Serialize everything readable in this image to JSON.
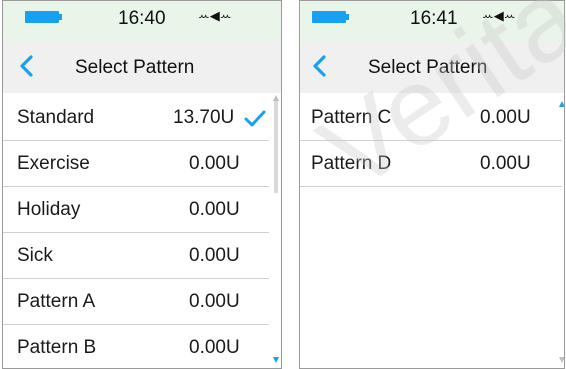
{
  "colors": {
    "accent": "#18a1f2",
    "status_bar_bg": "#e9f5e9",
    "title_bar_bg": "#f0f0f0",
    "divider": "#d0d0d0"
  },
  "screens": [
    {
      "status": {
        "time": "16:40",
        "battery_icon": "battery-icon",
        "mode_icon": "silent-vibrate-icon"
      },
      "header": {
        "back_icon": "back-chevron-icon",
        "title": "Select Pattern"
      },
      "rows": [
        {
          "name": "Standard",
          "value": "13.70U",
          "selected": true
        },
        {
          "name": "Exercise",
          "value": "0.00U"
        },
        {
          "name": "Holiday",
          "value": "0.00U"
        },
        {
          "name": "Sick",
          "value": "0.00U"
        },
        {
          "name": "Pattern A",
          "value": "0.00U"
        },
        {
          "name": "Pattern B",
          "value": "0.00U"
        }
      ]
    },
    {
      "status": {
        "time": "16:41",
        "battery_icon": "battery-icon",
        "mode_icon": "silent-vibrate-icon"
      },
      "header": {
        "back_icon": "back-chevron-icon",
        "title": "Select Pattern"
      },
      "rows": [
        {
          "name": "Pattern C",
          "value": "0.00U"
        },
        {
          "name": "Pattern D",
          "value": "0.00U"
        }
      ]
    }
  ],
  "watermark": "Veritas"
}
